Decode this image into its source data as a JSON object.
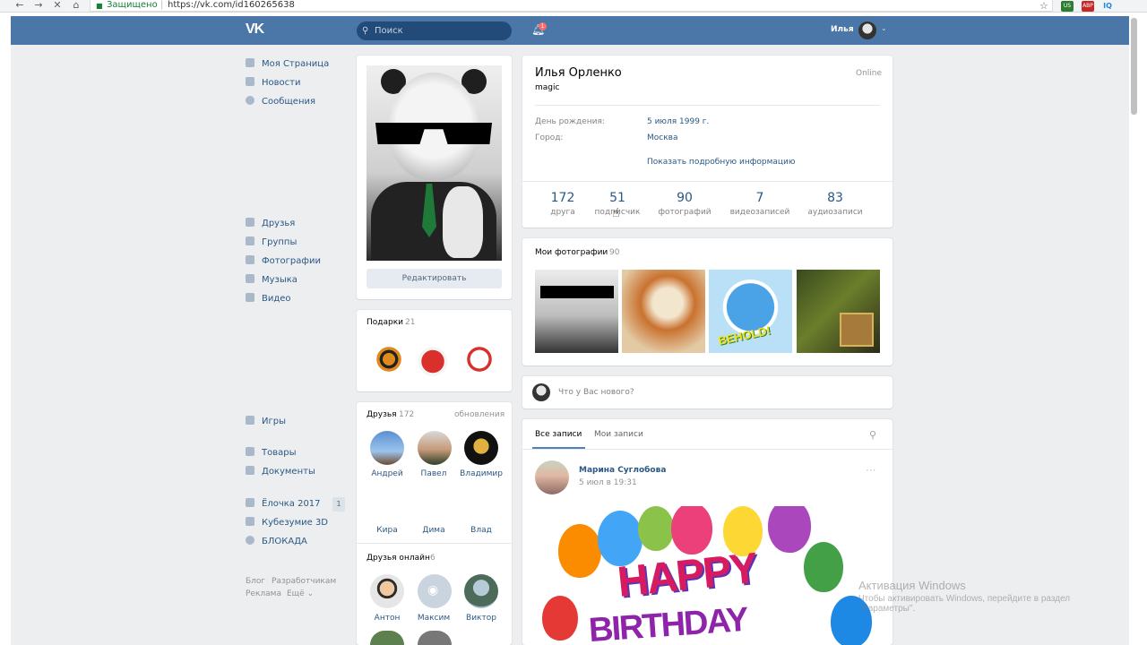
{
  "browser": {
    "secure_label": "Защищено",
    "url": "https://vk.com/id160265638",
    "ext_us": "US",
    "ext_abp": "ABP",
    "ext_iq": "IQ"
  },
  "header": {
    "logo": "VK",
    "search_placeholder": "Поиск",
    "notifications_count": "1",
    "user_name": "Илья"
  },
  "menu": {
    "my_page": "Моя Страница",
    "news": "Новости",
    "messages": "Сообщения",
    "friends": "Друзья",
    "groups": "Группы",
    "photos": "Фотографии",
    "music": "Музыка",
    "video": "Видео",
    "games": "Игры",
    "goods": "Товары",
    "documents": "Документы",
    "app1": "Ёлочка 2017",
    "app1_badge": "1",
    "app2": "Кубезумие 3D",
    "app3": "БЛОКАДА",
    "footer_blog": "Блог",
    "footer_dev": "Разработчикам",
    "footer_ads": "Реклама",
    "footer_more": "Ещё"
  },
  "avatar": {
    "edit_button": "Редактировать"
  },
  "gifts": {
    "title": "Подарки",
    "count": "21"
  },
  "friends": {
    "title": "Друзья",
    "count": "172",
    "updates": "обновления",
    "row1": [
      "Андрей",
      "Павел",
      "Владимир"
    ],
    "row2": [
      "Кира",
      "Дима",
      "Влад"
    ]
  },
  "friends_online": {
    "title": "Друзья онлайн",
    "count": "6",
    "names": [
      "Антон",
      "Максим",
      "Виктор"
    ]
  },
  "profile": {
    "name": "Илья Орленко",
    "status": "magic",
    "online": "Online",
    "birthday_label": "День рождения:",
    "birthday_value": "5 июля 1999 г.",
    "city_label": "Город:",
    "city_value": "Москва",
    "show_more": "Показать подробную информацию"
  },
  "stats": [
    {
      "num": "172",
      "label": "друга"
    },
    {
      "num": "51",
      "label": "подписчик"
    },
    {
      "num": "90",
      "label": "фотографий"
    },
    {
      "num": "7",
      "label": "видеозаписей"
    },
    {
      "num": "83",
      "label": "аудиозаписи"
    }
  ],
  "my_photos": {
    "title": "Мои фотографии",
    "count": "90",
    "behold_text": "BEHOLD!"
  },
  "composer": {
    "placeholder": "Что у Вас нового?"
  },
  "wall": {
    "tab_all": "Все записи",
    "tab_mine": "Мои записи",
    "post_author": "Марина Суглобова",
    "post_time": "5 июл в 19:31",
    "post_dots": "···",
    "banner_line1": "HAPPY",
    "banner_line2": "BIRTHDAY"
  },
  "watermark": {
    "title": "Активация Windows",
    "line1": "Чтобы активировать Windows, перейдите в раздел",
    "line2": "\"Параметры\"."
  },
  "colors": {
    "vk_blue": "#4a76a8",
    "link": "#2a5885",
    "page_bg": "#edeef0"
  }
}
